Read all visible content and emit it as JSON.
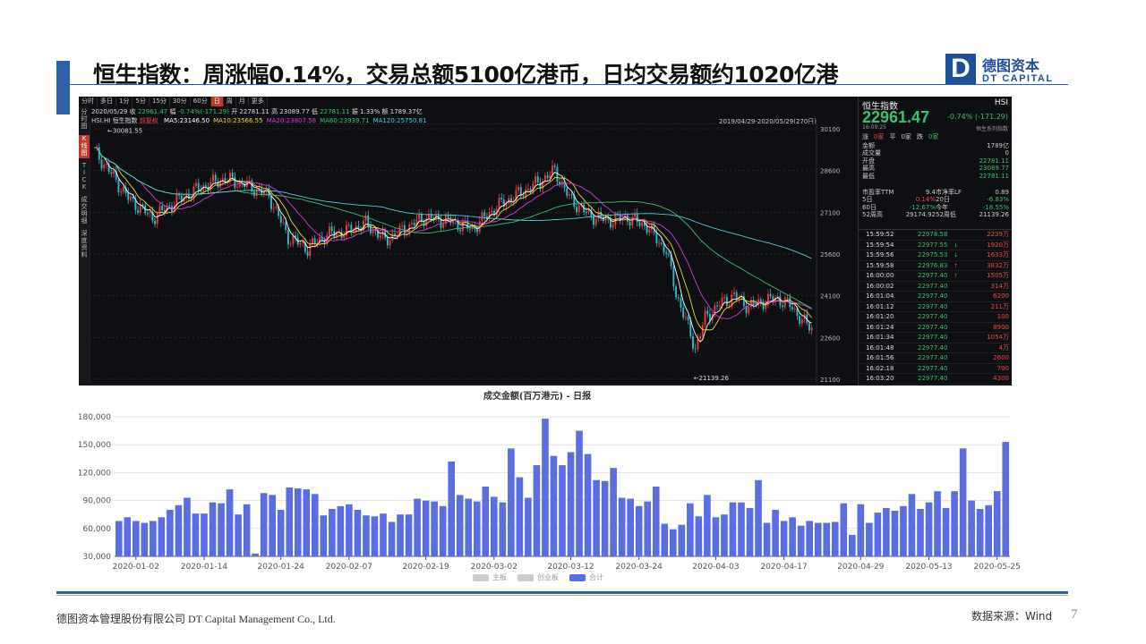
{
  "slide": {
    "title": "恒生指数：周涨幅0.14%，交易总额5100亿港币，日均交易额约1020亿港",
    "logo": {
      "mark": "D",
      "cn": "德图资本",
      "en": "DT CAPITAL"
    },
    "footer_left": "德图资本管理股份有限公司  DT Capital Management Co., Ltd.",
    "footer_right": "数据来源：Wind",
    "page_number": "7"
  },
  "terminal": {
    "toolbar": [
      "分时",
      "多日",
      "1分",
      "5分",
      "15分",
      "30分",
      "60分",
      "日",
      "周",
      "月",
      "更多"
    ],
    "toolbar_active": "日",
    "toolbar_right": [
      "复权",
      "叠加",
      "画线",
      "工具",
      "F9",
      "隐藏"
    ],
    "side_tabs": [
      "分时图",
      "K线图",
      "TICK",
      "成交明细",
      "深度资料"
    ],
    "side_active": "K线图",
    "info_date": "2020/05/29",
    "info_close_label": "收",
    "info_close": "22961.47",
    "info_change_label": "幅",
    "info_change": "-0.74%(-171.29)",
    "info_open_label": "开",
    "info_open": "22781.11",
    "info_high_label": "高",
    "info_high": "23089.77",
    "info_low_label": "低",
    "info_low": "22781.11",
    "info_amp_label": "振",
    "info_amp": "1.33%",
    "info_amount_label": "额",
    "info_amount": "1789.37亿",
    "code_label": "HSI.HI",
    "name_label": "恒生指数",
    "forward_label": "前复权",
    "ma": [
      {
        "label": "MA5:23146.50",
        "color": "#ffffff"
      },
      {
        "label": "MA10:23566.55",
        "color": "#f2d33c"
      },
      {
        "label": "MA20:23807.58",
        "color": "#d63bd6"
      },
      {
        "label": "MA60:23939.71",
        "color": "#3cc06a"
      },
      {
        "label": "MA120:25750.81",
        "color": "#5bc8d6"
      }
    ],
    "range": "2019/04/29-2020/05/29(270日)",
    "price_axis": [
      "30100",
      "28600",
      "27100",
      "25600",
      "24100",
      "22600",
      "21100"
    ],
    "marker_high": "30081.55",
    "marker_low": "21139.26"
  },
  "quote": {
    "name": "恒生指数",
    "code": "HSI",
    "price": "22961.47",
    "change": "-0.74% (-171.29)",
    "time": "16:09:25",
    "series": "恒生系列指数",
    "up_label": "涨",
    "up": "0家",
    "flat_label": "平",
    "flat": "0家",
    "down_label": "跌",
    "down": "0家",
    "stats": [
      {
        "k": "金额",
        "v": "1789亿",
        "c": ""
      },
      {
        "k": "成交量",
        "v": "0",
        "c": ""
      },
      {
        "k": "开盘",
        "v": "22781.11",
        "c": "g"
      },
      {
        "k": "最高",
        "v": "23089.77",
        "c": "g"
      },
      {
        "k": "最低",
        "v": "22781.11",
        "c": "g"
      }
    ],
    "grid": [
      [
        "市盈率TTM",
        "9.4",
        "市净率LF",
        "0.89"
      ],
      [
        "5日",
        "0.14%",
        "20日",
        "-6.83%"
      ],
      [
        "60日",
        "-12.67%",
        "今年",
        "-18.55%"
      ],
      [
        "52周高",
        "29174.92",
        "52周低",
        "21139.26"
      ]
    ],
    "ticks": [
      {
        "t": "15:59:52",
        "p": "22978.58",
        "a": "",
        "v": "2239万"
      },
      {
        "t": "15:59:54",
        "p": "22977.55",
        "a": "↓",
        "v": "1920万"
      },
      {
        "t": "15:59:56",
        "p": "22975.53",
        "a": "↓",
        "v": "1633万"
      },
      {
        "t": "15:59:58",
        "p": "22976.83",
        "a": "↑",
        "v": "3832万"
      },
      {
        "t": "16:00:00",
        "p": "22977.40",
        "a": "↑",
        "v": "1505万"
      },
      {
        "t": "16:00:02",
        "p": "22977.40",
        "a": "",
        "v": "314万"
      },
      {
        "t": "16:01:04",
        "p": "22977.40",
        "a": "",
        "v": "6200"
      },
      {
        "t": "16:01:12",
        "p": "22977.40",
        "a": "",
        "v": "211万"
      },
      {
        "t": "16:01:20",
        "p": "22977.40",
        "a": "",
        "v": "100"
      },
      {
        "t": "16:01:24",
        "p": "22977.40",
        "a": "",
        "v": "8900"
      },
      {
        "t": "16:01:34",
        "p": "22977.40",
        "a": "",
        "v": "1054万"
      },
      {
        "t": "16:01:48",
        "p": "22977.40",
        "a": "",
        "v": "4万"
      },
      {
        "t": "16:01:56",
        "p": "22977.40",
        "a": "",
        "v": "2600"
      },
      {
        "t": "16:02:18",
        "p": "22977.40",
        "a": "",
        "v": "700"
      },
      {
        "t": "16:03:20",
        "p": "22977.40",
        "a": "",
        "v": "4300"
      }
    ]
  },
  "chart_data": {
    "type": "bar",
    "title": "成交金额(百万港元) - 日报",
    "ylim": [
      30000,
      180000
    ],
    "y_ticks": [
      "180,000",
      "150,000",
      "120,000",
      "90,000",
      "60,000",
      "30,000"
    ],
    "x_tick_labels": [
      "2020-01-02",
      "2020-01-14",
      "2020-01-24",
      "2020-02-07",
      "2020-02-19",
      "2020-03-02",
      "2020-03-12",
      "2020-03-24",
      "2020-04-03",
      "2020-04-17",
      "2020-04-29",
      "2020-05-13",
      "2020-05-25"
    ],
    "legend": [
      "主板",
      "创业板",
      "合计"
    ],
    "legend_colors": [
      "#cccccc",
      "#cccccc",
      "#5b6ee1"
    ],
    "series": [
      {
        "name": "合计",
        "color": "#5b6ee1",
        "values": [
          68000,
          72000,
          68000,
          66000,
          68000,
          72000,
          80000,
          85000,
          93000,
          76000,
          76000,
          88000,
          87000,
          102000,
          75000,
          86000,
          33000,
          98000,
          96000,
          80000,
          104000,
          103000,
          102000,
          97000,
          74000,
          81000,
          84000,
          86000,
          80000,
          74000,
          73000,
          76000,
          67000,
          75000,
          75000,
          92000,
          90000,
          89000,
          84000,
          132000,
          96000,
          92000,
          89000,
          105000,
          94000,
          88000,
          146000,
          115000,
          93000,
          128000,
          178000,
          138000,
          128000,
          142000,
          165000,
          140000,
          112000,
          111000,
          125000,
          93000,
          92000,
          84000,
          89000,
          105000,
          65000,
          59000,
          64000,
          87000,
          73000,
          96000,
          72000,
          75000,
          88000,
          88000,
          82000,
          112000,
          66000,
          80000,
          68000,
          72000,
          63000,
          68000,
          66000,
          66000,
          67000,
          87000,
          53000,
          86000,
          66000,
          77000,
          82000,
          79000,
          84000,
          97000,
          81000,
          88000,
          100000,
          82000,
          100000,
          146000,
          90000,
          81000,
          85000,
          100000,
          153000
        ]
      }
    ]
  }
}
